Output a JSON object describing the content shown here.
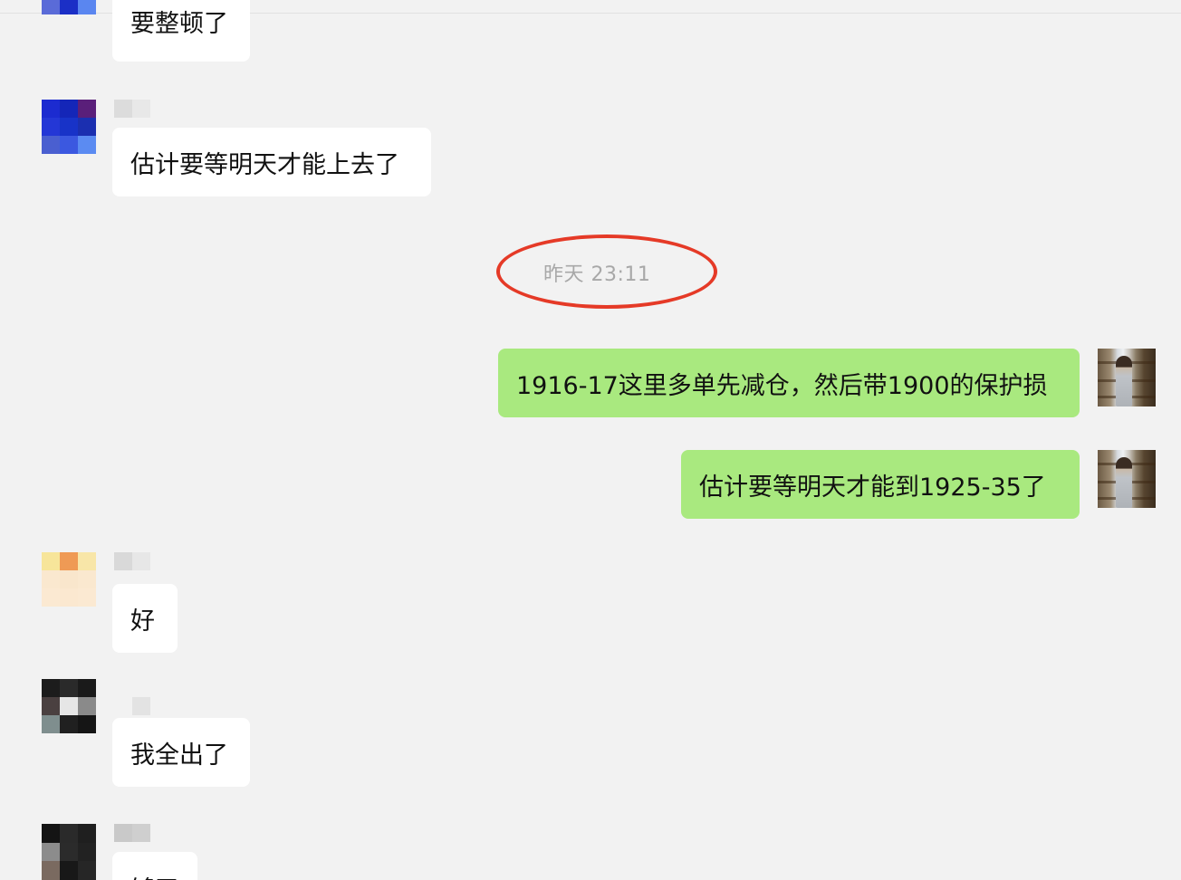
{
  "chat": {
    "timestamp": "昨天 23:11",
    "messages": [
      {
        "text": "要整顿了"
      },
      {
        "text": "估计要等明天才能上去了"
      },
      {
        "text": "1916-17这里多单先减仓，然后带1900的保护损"
      },
      {
        "text": "估计要等明天才能到1925-35了"
      },
      {
        "text": "好"
      },
      {
        "text": "我全出了"
      },
      {
        "text": "够了"
      }
    ]
  },
  "colors": {
    "background": "#f2f2f2",
    "incoming_bubble": "#ffffff",
    "outgoing_bubble": "#a9e97f",
    "timestamp_text": "#a8a8a8",
    "highlight_ring": "#e53a27"
  }
}
